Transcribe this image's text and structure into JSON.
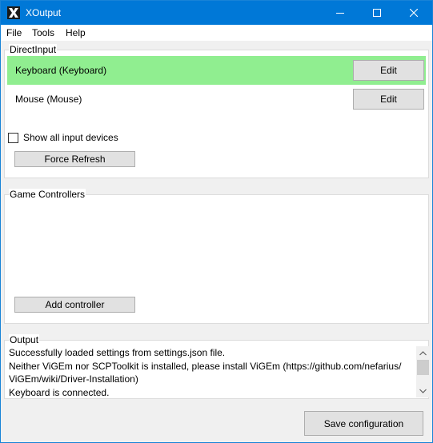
{
  "window": {
    "title": "XOutput"
  },
  "menu": {
    "items": [
      "File",
      "Tools",
      "Help"
    ]
  },
  "direct_input": {
    "label": "DirectInput",
    "devices": [
      {
        "name": "Keyboard (Keyboard)",
        "edit_label": "Edit",
        "selected": true
      },
      {
        "name": "Mouse (Mouse)",
        "edit_label": "Edit",
        "selected": false
      }
    ],
    "show_all_label": "Show all input devices",
    "show_all_checked": false,
    "refresh_label": "Force Refresh"
  },
  "game_controllers": {
    "label": "Game Controllers",
    "add_label": "Add controller"
  },
  "output": {
    "label": "Output",
    "lines": [
      "Successfully loaded settings from settings.json file.",
      "Neither ViGEm nor SCPToolkit is installed, please install ViGEm (https://github.com/nefarius/",
      "ViGEm/wiki/Driver-Installation)",
      "Keyboard is connected."
    ]
  },
  "footer": {
    "save_label": "Save configuration"
  },
  "colors": {
    "titlebar": "#0078d7",
    "selected_row": "#90ee90",
    "button_face": "#e1e1e1"
  },
  "icons": {
    "app": "xoutput-logo-icon",
    "minimize": "minimize-icon",
    "maximize": "maximize-icon",
    "close": "close-icon",
    "scroll_up": "chevron-up-icon",
    "scroll_down": "chevron-down-icon"
  }
}
